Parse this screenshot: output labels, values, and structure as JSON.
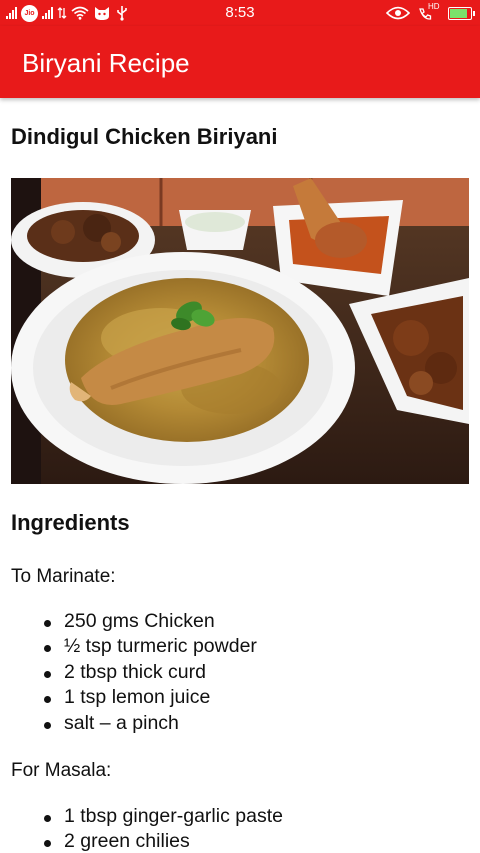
{
  "status_bar": {
    "carrier": "Jio",
    "time": "8:53",
    "hd_label": "HD"
  },
  "app_bar": {
    "title": "Biryani Recipe"
  },
  "recipe": {
    "title": "Dindigul Chicken Biriyani",
    "image_alt": "Plate of chicken biryani with side dishes",
    "ingredients_heading": "Ingredients",
    "marinate": {
      "heading": "To Marinate:",
      "items": [
        "250 gms Chicken",
        "½ tsp turmeric powder",
        "2 tbsp thick curd",
        "1 tsp lemon juice",
        "salt – a pinch"
      ]
    },
    "masala": {
      "heading": "For Masala:",
      "items": [
        "1 tbsp ginger-garlic paste",
        "2 green chilies"
      ]
    }
  },
  "colors": {
    "primary": "#e81a1a",
    "battery_fill": "#7be36b"
  }
}
